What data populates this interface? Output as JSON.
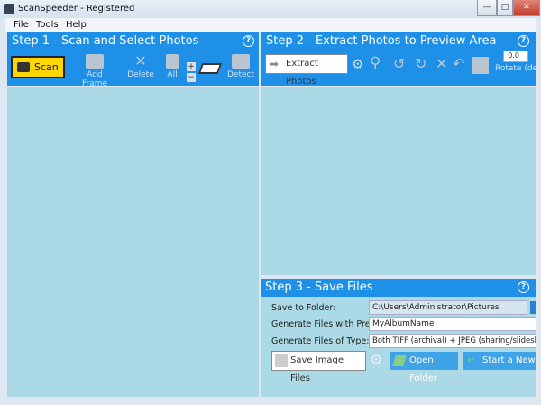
{
  "window": {
    "title": "ScanSpeeder - Registered",
    "min": "—",
    "max": "□",
    "close": "✕"
  },
  "menu": [
    "File",
    "Tools",
    "Help"
  ],
  "step1": {
    "title": "Step 1 - Scan and Select Photos",
    "help": "?",
    "scan": "Scan",
    "add_frame": "Add Frame",
    "delete": "Delete",
    "all": "All",
    "plus": "+",
    "minus": "−",
    "detect": "Detect"
  },
  "step2": {
    "title": "Step 2 - Extract Photos to Preview Area",
    "help": "?",
    "extract": "Extract Photos",
    "rotate_value": "0.0",
    "rotate_label": "Rotate (deg)"
  },
  "step3": {
    "title": "Step 3 - Save Files",
    "help": "?",
    "folder_label": "Save to Folder:",
    "folder_value": "C:\\Users\\Administrator\\Pictures",
    "prefix_label": "Generate Files with Prefix:",
    "prefix_value": "MyAlbumName",
    "type_label": "Generate Files of Type:",
    "type_value": "Both TIFF (archival) + JPEG (sharing/slideshows)",
    "save": "Save Image Files",
    "open_folder": "Open Folder",
    "new_scan": "Start a New Scan"
  },
  "colors": {
    "header": "#1e90e8",
    "area": "#acd9e6",
    "scan_button": "#ffd700"
  }
}
